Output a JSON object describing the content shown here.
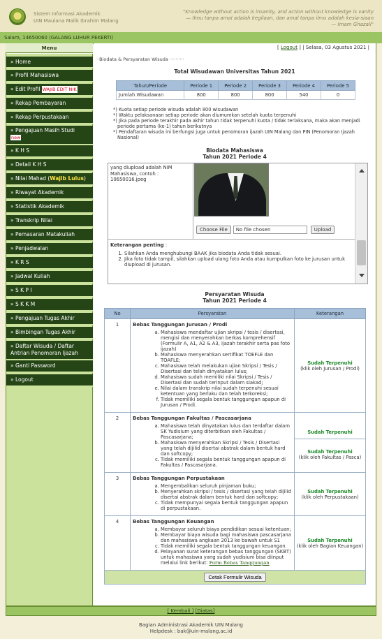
{
  "header": {
    "site_line1": "Sistem Informasi Akademik",
    "site_line2": "UIN Maulana Malik Ibrahim Malang",
    "quote_line1": "\"Knowledge without action is insanity, and action without knowledge is vanity",
    "quote_line2": "— Ilmu tanpa amal adalah kegilaan, dan amal tanpa ilmu adalah kesia-siaan",
    "quote_line3": "— Imam Ghazali\""
  },
  "userbar": {
    "salam": "Salam, 14650060 (GALANG LUHUR PEKERTI)"
  },
  "menu": {
    "title": "Menu",
    "items": [
      {
        "label": "» Home"
      },
      {
        "label": "» Profil Mahasiswa"
      },
      {
        "label": "» Edit Profil",
        "badge": "WAJIB EDIT NIK"
      },
      {
        "label": "» Rekap Pembayaran"
      },
      {
        "label": "» Rekap Perpustakaan"
      },
      {
        "label": "» Pengajuan Masih Studi",
        "badge": "new"
      },
      {
        "label": "» K H S"
      },
      {
        "label": "» Detail K H S"
      },
      {
        "label": "» Nilai Mahad (",
        "strong": "Wajib Lulus",
        "suffix": ")"
      },
      {
        "label": "» Riwayat Akademik"
      },
      {
        "label": "» Statistik Akademik"
      },
      {
        "label": "» Transkrip Nilai"
      },
      {
        "label": "» Pemasaran Matakuliah"
      },
      {
        "label": "» Penjadwalan"
      },
      {
        "label": "» K R S"
      },
      {
        "label": "» Jadwal Kuliah"
      },
      {
        "label": "» S K P I"
      },
      {
        "label": "» S K K M"
      },
      {
        "label": "» Pengajuan Tugas Akhir"
      },
      {
        "label": "» Bimbingan Tugas Akhir"
      },
      {
        "label": "» Daftar Wisuda / Daftar Antrian Penomoran Ijazah"
      },
      {
        "label": "» Ganti Password"
      },
      {
        "label": "» Logout"
      }
    ]
  },
  "topline": {
    "logout": "Logout",
    "date": "| Selasa, 03 Agustus 2021 |"
  },
  "breadcrumb": "Biodata & Persyaratan Wisuda",
  "total_wisudawan": {
    "title": "Total Wisudawan Universitas Tahun 2021",
    "headers": [
      "Tahun/Periode",
      "Periode 1",
      "Periode 2",
      "Periode 3",
      "Periode 4",
      "Periode 5"
    ],
    "row": [
      "Jumlah Wisudawan",
      "800",
      "800",
      "800",
      "540",
      "0"
    ]
  },
  "notes": [
    "*) Kuota setiap periode wisuda adalah 800 wisudawan",
    "*) Waktu pelaksanaan setiap periode akan diumumkan setelah kuota terpenuhi",
    "*) Jika pada periode terakhir pada akhir tahun tidak terpenuhi kuota / tidak terlaksana, maka akan menjadi periode pertama (ke-1) tahun berikutnya",
    "*) Pendaftaran wisuda ini berfungsi juga untuk penomoran ijazah UIN Malang dan PIN (Penomoran Ijazah Nasional)"
  ],
  "biodata": {
    "title_line1": "Biodata Mahasiswa",
    "title_line2": "Tahun 2021 Periode 4",
    "left_text": "yang diupload adalah NIM Mahasiswa, contoh : 10650016.jpeg",
    "choose_file": "Choose File",
    "no_file": "No file chosen",
    "upload": "Upload",
    "keterangan_label": "Keterangan penting",
    "keterangan_colon": " :",
    "keterangan": [
      "Silahkan Anda menghubungi BAAK jika biodata Anda tidak sesuai.",
      "Jika foto tidak tampil, silahkan upload ulang foto Anda atau kumpulkan foto ke jurusan untuk diupload di jurusan."
    ]
  },
  "persyaratan": {
    "title_line1": "Persyaratan Wisuda",
    "title_line2": "Tahun 2021 Periode 4",
    "headers": [
      "No",
      "Persyaratan",
      "Keterangan"
    ],
    "rows": [
      {
        "no": "1",
        "title": "Bebas Tanggungan Jurusan / Prodi",
        "items": [
          "Mahasiswa mendaftar ujian skripsi / tesis / disertasi, mengisi dan menyerahkan berkas komprehensif (Formulir A, A1, A2 & A3, ijazah terakhir serta pas foto ijazah)",
          "Mahasiswa menyerahkan sertifikat TOEFLE dan TOAFLE;",
          "Mahasiswa telah melakukan ujian Skripsi / Tesis / Disertasi dan telah dinyatakan lulus;",
          "Mahasiswa sudah memiliki nilai Skripsi / Tesis / Disertasi dan sudah terinput dalam siakad;",
          "Nilai dalam transkrip nilai sudah terpenuhi sesuai ketentuan yang berlaku dan telah terkoreksi;",
          "Tidak memiliki segala bentuk tanggungan apapun di Jurusan / Prodi."
        ],
        "status": "Sudah Terpenuhi",
        "note": "(klik oleh Jurusan / Prodi)"
      },
      {
        "no": "2",
        "title": "Bebas Tanggungan Fakultas / Pascasarjana",
        "items": [
          "Mahasiswa telah dinyatakan lulus dan terdaftar dalam SK Yudisium yang diterbitkan oleh Fakultas / Pascasarjana;",
          "Mahasiswa menyerahkan Skripsi / Tesis / Disertasi yang telah dijilid disertai abstrak dalam bentuk hard dan softcopy;",
          "Tidak memiliki segala bentuk tanggungan apapun di Fakultas / Pascasarjana."
        ],
        "status": "Sudah Terpenuhi",
        "status2": "Sudah Terpenuhi",
        "note": "(klik oleh Fakultas / Pasca)"
      },
      {
        "no": "3",
        "title": "Bebas Tanggungan Perpustakaan",
        "items": [
          "Mengembalikan seluruh pinjaman buku;",
          "Menyerahkan skripsi / tesis / disertasi yang telah dijilid disertai abstrak dalam bentuk hard dan softcopy;",
          "Tidak mempunyai segala bentuk tanggungan apapun di perpustakaan."
        ],
        "status": "Sudah Terpenuhi",
        "note": "(klik oleh Perpustakaan)"
      },
      {
        "no": "4",
        "title": "Bebas Tanggungan Keuangan",
        "items": [
          "Membayar seluruh biaya pendidikan sesuai ketentuan;",
          "Membayar biaya wisuda bagi mahasiswa pascasarjana dan mahasiswa angkaan 2013 ke bawah untuk S1",
          "Tidak memiliki segala bentuk tanggungan keuangan.",
          "Pelayanan surat keterangan bebas tanggungan (SKBT) untuk mahasiswa yang sudah yudisium bisa diinput melalui link berikut: "
        ],
        "link": "Form Bebas Tanggungan",
        "status": "Sudah Terpenuhi",
        "note": "(klik oleh Bagian Keuangan)"
      }
    ],
    "print_button": "Cetak Formulir Wisuda"
  },
  "bottombar": {
    "back": "[ Kembali ]",
    "top": "[Diatas]"
  },
  "footer": {
    "line1": "Bagian Administrasi Akademik UIN Malang",
    "line2": "Helpdesk : bak@uin-malang.ac.id"
  }
}
